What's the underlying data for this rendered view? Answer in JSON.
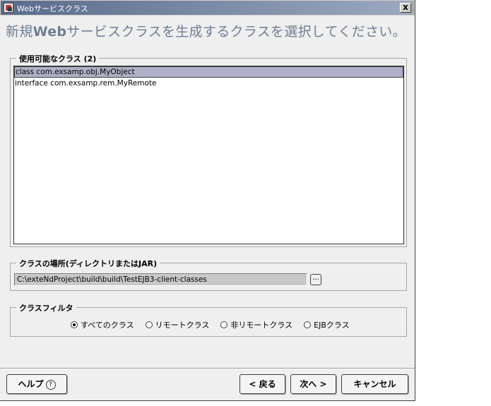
{
  "window": {
    "title": "Webサービスクラス",
    "close_label": "x"
  },
  "heading": {
    "prefix": "新規",
    "bold": "Web",
    "suffix": "サービスクラスを生成するクラスを選択してください。"
  },
  "available_classes": {
    "legend": "使用可能なクラス (2)",
    "items": [
      {
        "label": "class com.exsamp.obj.MyObject",
        "selected": true
      },
      {
        "label": "interface com.exsamp.rem.MyRemote",
        "selected": false
      }
    ]
  },
  "class_location": {
    "legend": "クラスの場所(ディレクトリまたはJAR)",
    "path": "C:\\exteNdProject\\build\\build\\TestEJB3-client-classes",
    "browse_label": "..."
  },
  "class_filter": {
    "legend": "クラスフィルタ",
    "options": [
      {
        "label": "すべてのクラス",
        "checked": true
      },
      {
        "label": "リモートクラス",
        "checked": false
      },
      {
        "label": "非リモートクラス",
        "checked": false
      },
      {
        "label": "EJBクラス",
        "checked": false
      }
    ]
  },
  "buttons": {
    "help": "ヘルプ",
    "help_glyph": "?",
    "back": "< 戻る",
    "next": "次へ >",
    "cancel": "キャンセル"
  }
}
